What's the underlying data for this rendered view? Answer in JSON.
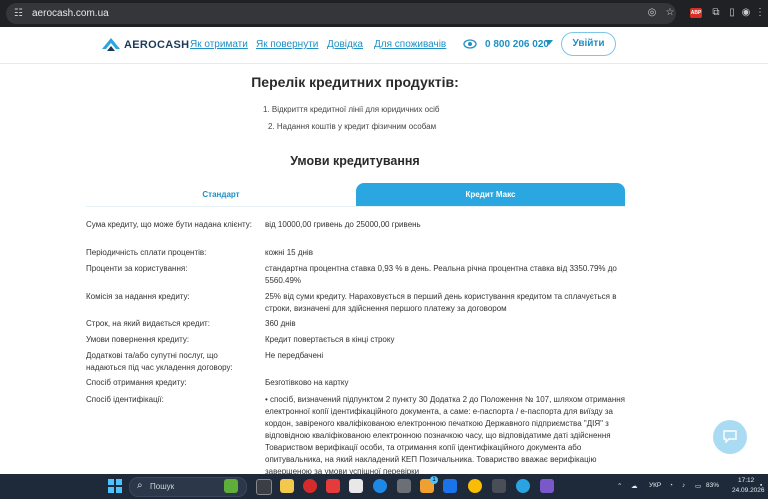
{
  "browser": {
    "url": "aerocash.com.ua",
    "ext_badge": "ABP"
  },
  "header": {
    "logo_text": "AEROCASH",
    "nav": [
      "Як отримати",
      "Як повернути",
      "Довідка",
      "Для споживачів"
    ],
    "phone": "0 800 206 020",
    "login_label": "Увійти"
  },
  "content": {
    "products_title": "Перелік кредитних продуктів:",
    "products": [
      "1. Відкриття кредитної лінії для юридичних осіб",
      "2. Надання коштів у кредит фізичним особам"
    ],
    "terms_title": "Умови кредитування",
    "tabs": [
      "Стандарт",
      "Кредит Макс"
    ],
    "active_tab": "Кредит Макс",
    "rows": [
      {
        "label": "Сума кредиту, що може бути надана клієнту:",
        "value": "від 10000,00 гривень до 25000,00 гривень"
      },
      {
        "label": "Періодичність сплати процентів:",
        "value": "кожні 15 днів"
      },
      {
        "label": "Проценти за користування:",
        "value": "стандартна процентна ставка 0,93 % в день. Реальна річна процентна ставка від 3350.79% до 5560.49%"
      },
      {
        "label": "Комісія за надання кредиту:",
        "value": "25% від суми кредиту. Нараховується в перший день користування кредитом та сплачується в строки, визначені для здійснення першого платежу за договором"
      },
      {
        "label": "Строк, на який видається кредит:",
        "value": "360 днів"
      },
      {
        "label": "Умови повернення кредиту:",
        "value": "Кредит повертається в кінці строку"
      },
      {
        "label": "Додаткові та/або супутні послуг, що надаються під час укладення договору:",
        "value": "Не передбачені"
      },
      {
        "label": "Спосіб отримання кредиту:",
        "value": "Безготівково на картку"
      },
      {
        "label": "Спосіб ідентифікації:",
        "value": "• спосіб, визначений підпунктом 2 пункту 30 Додатка 2 до Положення № 107, шляхом отримання електронної копії ідентифікаційного документа, а саме: е-паспорта / е-паспорта для виїзду за кордон, завіреного кваліфікованою електронною печаткою Державного підприємства \"ДІЯ\" з відповідною кваліфікованою електронною позначкою часу, що відповідатиме даті здійснення Товариством верифікації особи, та отримання копії ідентифікаційного документа або опитувальника, на який накладений КЕП Позичальника. Товариство вважає верифікацію завершеною за умови успішної перевірки"
      }
    ]
  },
  "taskbar": {
    "search_placeholder": "Пошук",
    "notification_count": "1",
    "lang": "УКР",
    "battery": "83%",
    "time": "17:12",
    "date": "24.09.2026"
  },
  "colors": {
    "accent": "#2aa6e0",
    "link": "#1f8fc4",
    "brand_dark": "#1b3a57"
  }
}
